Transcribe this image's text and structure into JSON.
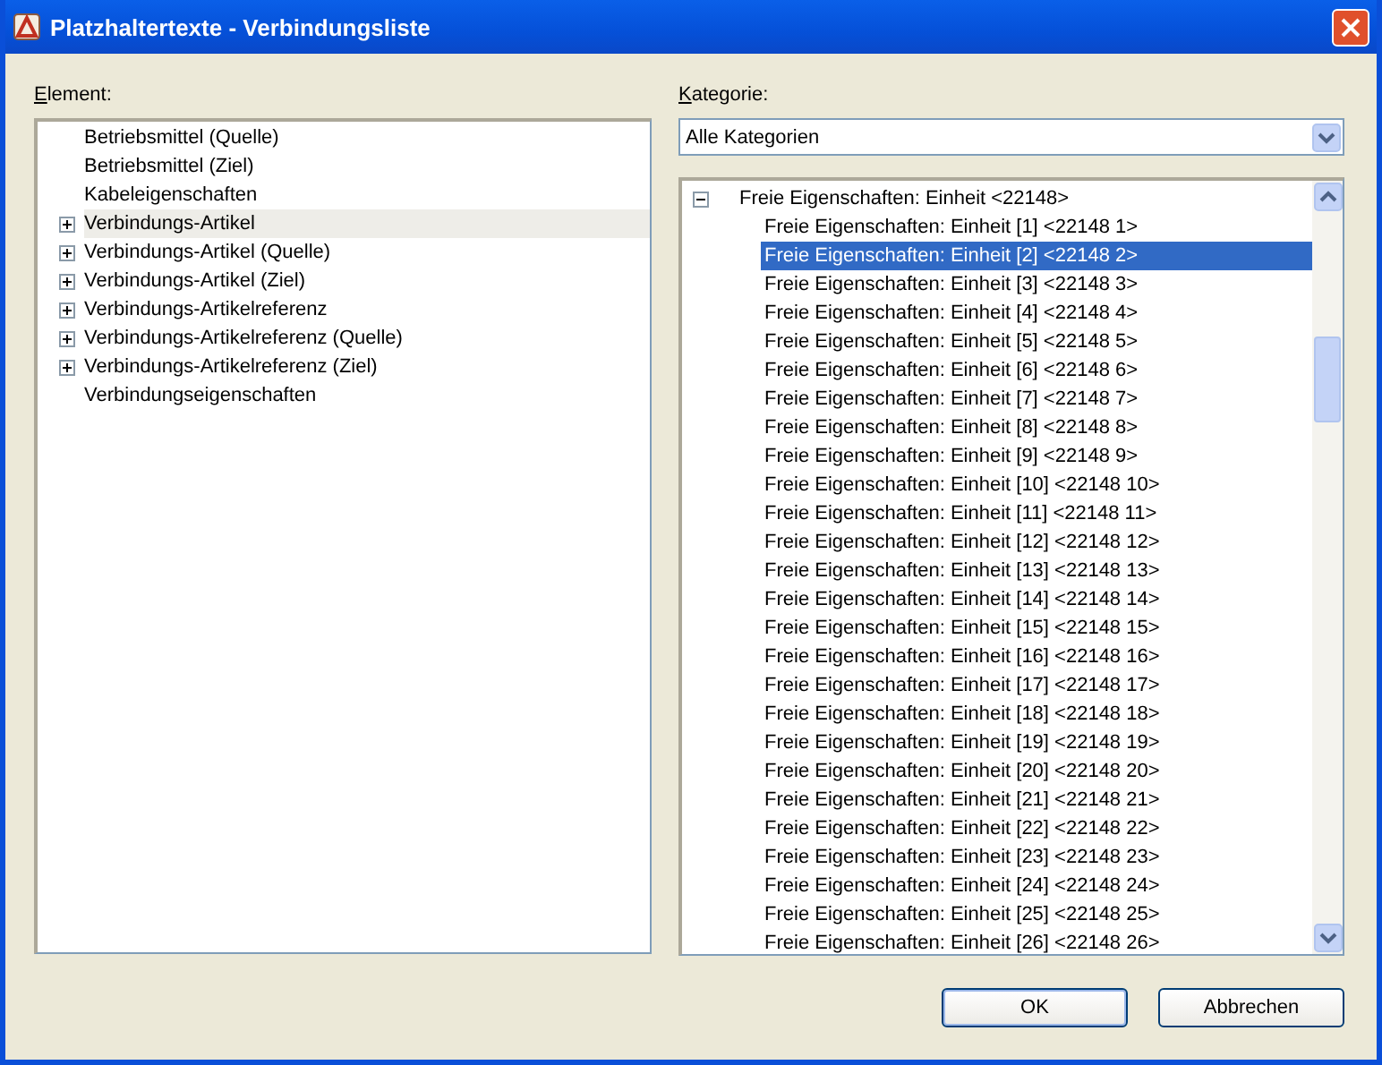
{
  "window": {
    "title": "Platzhaltertexte - Verbindungsliste"
  },
  "element_list": {
    "label": "Element:",
    "items": [
      {
        "label": "Betriebsmittel (Quelle)",
        "expandable": false,
        "hovered": false
      },
      {
        "label": "Betriebsmittel (Ziel)",
        "expandable": false,
        "hovered": false
      },
      {
        "label": "Kabeleigenschaften",
        "expandable": false,
        "hovered": false
      },
      {
        "label": "Verbindungs-Artikel",
        "expandable": true,
        "hovered": true
      },
      {
        "label": "Verbindungs-Artikel (Quelle)",
        "expandable": true,
        "hovered": false
      },
      {
        "label": "Verbindungs-Artikel (Ziel)",
        "expandable": true,
        "hovered": false
      },
      {
        "label": "Verbindungs-Artikelreferenz",
        "expandable": true,
        "hovered": false
      },
      {
        "label": "Verbindungs-Artikelreferenz (Quelle)",
        "expandable": true,
        "hovered": false
      },
      {
        "label": "Verbindungs-Artikelreferenz (Ziel)",
        "expandable": true,
        "hovered": false
      },
      {
        "label": "Verbindungseigenschaften",
        "expandable": false,
        "hovered": false
      }
    ]
  },
  "category": {
    "label": "Kategorie:",
    "value": "Alle Kategorien"
  },
  "tree": {
    "label": "Freie Eigenschaften: Einheit <22148>",
    "expanded": true,
    "selected": false,
    "children": [
      {
        "label": "Freie Eigenschaften: Einheit [1] <22148 1>",
        "selected": false
      },
      {
        "label": "Freie Eigenschaften: Einheit [2] <22148 2>",
        "selected": true
      },
      {
        "label": "Freie Eigenschaften: Einheit [3] <22148 3>",
        "selected": false
      },
      {
        "label": "Freie Eigenschaften: Einheit [4] <22148 4>",
        "selected": false
      },
      {
        "label": "Freie Eigenschaften: Einheit [5] <22148 5>",
        "selected": false
      },
      {
        "label": "Freie Eigenschaften: Einheit [6] <22148 6>",
        "selected": false
      },
      {
        "label": "Freie Eigenschaften: Einheit [7] <22148 7>",
        "selected": false
      },
      {
        "label": "Freie Eigenschaften: Einheit [8] <22148 8>",
        "selected": false
      },
      {
        "label": "Freie Eigenschaften: Einheit [9] <22148 9>",
        "selected": false
      },
      {
        "label": "Freie Eigenschaften: Einheit [10] <22148 10>",
        "selected": false
      },
      {
        "label": "Freie Eigenschaften: Einheit [11] <22148 11>",
        "selected": false
      },
      {
        "label": "Freie Eigenschaften: Einheit [12] <22148 12>",
        "selected": false
      },
      {
        "label": "Freie Eigenschaften: Einheit [13] <22148 13>",
        "selected": false
      },
      {
        "label": "Freie Eigenschaften: Einheit [14] <22148 14>",
        "selected": false
      },
      {
        "label": "Freie Eigenschaften: Einheit [15] <22148 15>",
        "selected": false
      },
      {
        "label": "Freie Eigenschaften: Einheit [16] <22148 16>",
        "selected": false
      },
      {
        "label": "Freie Eigenschaften: Einheit [17] <22148 17>",
        "selected": false
      },
      {
        "label": "Freie Eigenschaften: Einheit [18] <22148 18>",
        "selected": false
      },
      {
        "label": "Freie Eigenschaften: Einheit [19] <22148 19>",
        "selected": false
      },
      {
        "label": "Freie Eigenschaften: Einheit [20] <22148 20>",
        "selected": false
      },
      {
        "label": "Freie Eigenschaften: Einheit [21] <22148 21>",
        "selected": false
      },
      {
        "label": "Freie Eigenschaften: Einheit [22] <22148 22>",
        "selected": false
      },
      {
        "label": "Freie Eigenschaften: Einheit [23] <22148 23>",
        "selected": false
      },
      {
        "label": "Freie Eigenschaften: Einheit [24] <22148 24>",
        "selected": false
      },
      {
        "label": "Freie Eigenschaften: Einheit [25] <22148 25>",
        "selected": false
      },
      {
        "label": "Freie Eigenschaften: Einheit [26] <22148 26>",
        "selected": false
      }
    ]
  },
  "buttons": [
    {
      "label": "OK",
      "default": true
    },
    {
      "label": "Abbrechen",
      "default": false
    }
  ]
}
